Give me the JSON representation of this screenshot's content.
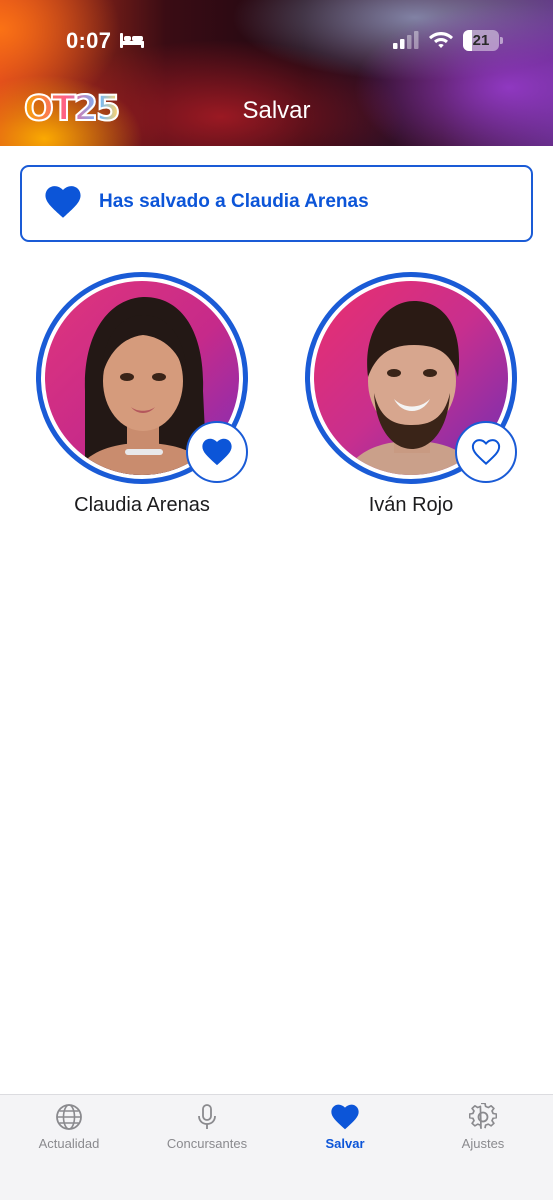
{
  "status_bar": {
    "time": "0:07",
    "battery_level": "21",
    "icons": [
      "bed-icon",
      "cellular-signal-icon",
      "wifi-icon",
      "battery-icon"
    ]
  },
  "header": {
    "logo_text": "OT25",
    "title": "Salvar"
  },
  "banner": {
    "icon": "heart-filled-icon",
    "message": "Has salvado a Claudia Arenas"
  },
  "contestants": [
    {
      "name": "Claudia Arenas",
      "saved": true,
      "vote_icon": "heart-filled-icon"
    },
    {
      "name": "Iván Rojo",
      "saved": false,
      "vote_icon": "heart-outline-icon"
    }
  ],
  "tab_bar": {
    "items": [
      {
        "label": "Actualidad",
        "icon": "globe-icon",
        "active": false
      },
      {
        "label": "Concursantes",
        "icon": "microphone-icon",
        "active": false
      },
      {
        "label": "Salvar",
        "icon": "heart-icon",
        "active": true
      },
      {
        "label": "Ajustes",
        "icon": "gear-icon",
        "active": false
      }
    ]
  },
  "colors": {
    "accent": "#0c55d8",
    "inactive_tab": "#8a8a8e",
    "tab_bar_bg": "#f4f4f6"
  }
}
